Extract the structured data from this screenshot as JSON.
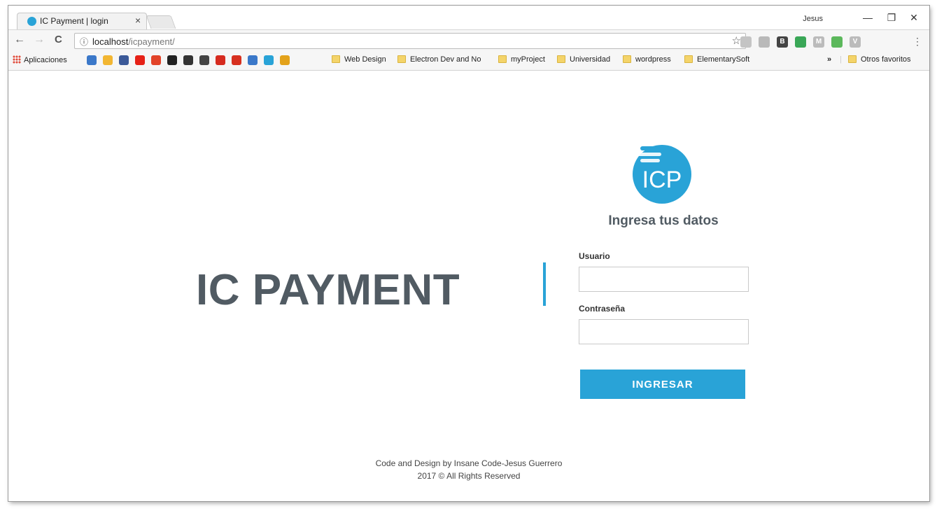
{
  "browser": {
    "tab_title": "IC Payment | login",
    "tab_close": "×",
    "profile": "Jesus",
    "window_controls": {
      "minimize": "—",
      "restore": "❐",
      "close": "✕"
    },
    "url": {
      "host": "localhost",
      "path": "/icpayment/"
    },
    "nav": {
      "back": "←",
      "forward": "→",
      "reload": "C",
      "info": "ⓘ"
    },
    "star": "☆",
    "extensions": [
      {
        "icon": "cloud-icon",
        "color": "#c4c4c4",
        "label": ""
      },
      {
        "icon": "square-icon",
        "color": "#b9b9b9",
        "label": ""
      },
      {
        "icon": "bootstrap-icon",
        "color": "#444444",
        "label": "B"
      },
      {
        "icon": "new-badge-icon",
        "color": "#3aa757",
        "label": ""
      },
      {
        "icon": "mail-icon",
        "color": "#bbbbbb",
        "label": "M"
      },
      {
        "icon": "green-ext-icon",
        "color": "#5cb85c",
        "label": ""
      },
      {
        "icon": "vue-icon",
        "color": "#bbbbbb",
        "label": "V"
      }
    ],
    "menu": "⋮"
  },
  "bookmarks": {
    "apps_label": "Aplicaciones",
    "icons": [
      {
        "name": "mail-icon",
        "color": "#3b78c9"
      },
      {
        "name": "drive-icon",
        "color": "#f2b632"
      },
      {
        "name": "facebook-icon",
        "color": "#3b5998"
      },
      {
        "name": "youtube-icon",
        "color": "#e62117"
      },
      {
        "name": "gitlab-icon",
        "color": "#e24329"
      },
      {
        "name": "github-icon",
        "color": "#222222"
      },
      {
        "name": "codepen-icon",
        "color": "#333333"
      },
      {
        "name": "power-icon",
        "color": "#444444"
      },
      {
        "name": "tomato-icon",
        "color": "#d62b1f"
      },
      {
        "name": "ebook-icon",
        "color": "#d7301f"
      },
      {
        "name": "shield-icon",
        "color": "#3b78c9"
      },
      {
        "name": "icp-icon",
        "color": "#29a3d7"
      },
      {
        "name": "envelope-icon",
        "color": "#e3a21a"
      }
    ],
    "folders": [
      "Web Design",
      "Electron Dev and No",
      "myProject",
      "Universidad",
      "wordpress",
      "ElementarySoft"
    ],
    "overflow": "»",
    "other": "Otros favoritos"
  },
  "page": {
    "brand": "IC PAYMENT",
    "logo_text": "ICP",
    "form_title": "Ingresa tus datos",
    "user_label": "Usuario",
    "user_value": "",
    "password_label": "Contraseña",
    "password_value": "",
    "submit_label": "INGRESAR",
    "footer_line1": "Code and Design by Insane Code-Jesus Guerrero",
    "footer_line2": "2017 © All Rights Reserved"
  },
  "colors": {
    "accent": "#29a3d7",
    "brand_text": "#515b63"
  }
}
